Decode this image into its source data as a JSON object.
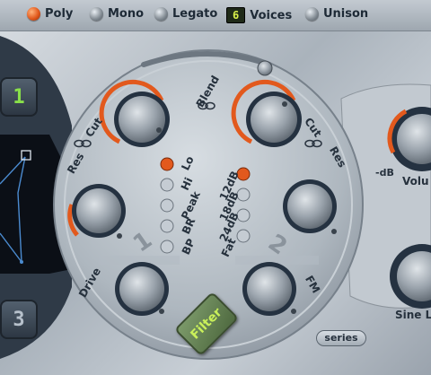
{
  "voice_modes": {
    "poly": "Poly",
    "mono": "Mono",
    "legato": "Legato",
    "voices_count": "6",
    "voices_label": "Voices",
    "unison": "Unison"
  },
  "filter_section": {
    "blend_label": "Blend",
    "filter1": {
      "cut_label": "Cut",
      "res_label": "Res",
      "drive_label": "Drive",
      "number": "1",
      "types": [
        "Lo",
        "Hi",
        "Peak",
        "BR",
        "BP"
      ],
      "selected_type": "Lo"
    },
    "filter2": {
      "cut_label": "Cut",
      "res_label": "Res",
      "fm_label": "FM",
      "number": "2",
      "slopes": [
        "12dB",
        "18dB",
        "24dB",
        "Fat"
      ],
      "selected_slope": "12dB"
    },
    "filter_button_label": "Filter",
    "series_label": "series"
  },
  "osc_slots": {
    "slot1": "1",
    "slot3": "3"
  },
  "right_panel": {
    "db_label": "-dB",
    "volume_label": "Volu",
    "sine_label": "Sine L"
  },
  "colors": {
    "accent_orange": "#e2591d",
    "active_green": "#c9f05a",
    "panel_dark": "#253241"
  }
}
